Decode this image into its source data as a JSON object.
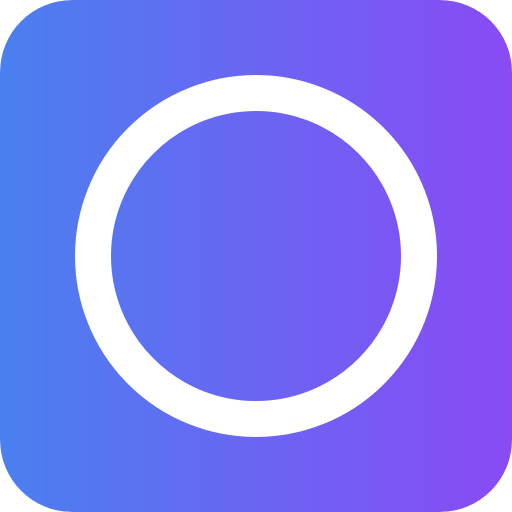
{
  "icon": {
    "name": "ring-icon",
    "shape": "rounded-square",
    "glyph": "ring"
  },
  "colors": {
    "gradient_start": "#4a80f0",
    "gradient_end": "#8a4af5",
    "ring": "#ffffff"
  }
}
